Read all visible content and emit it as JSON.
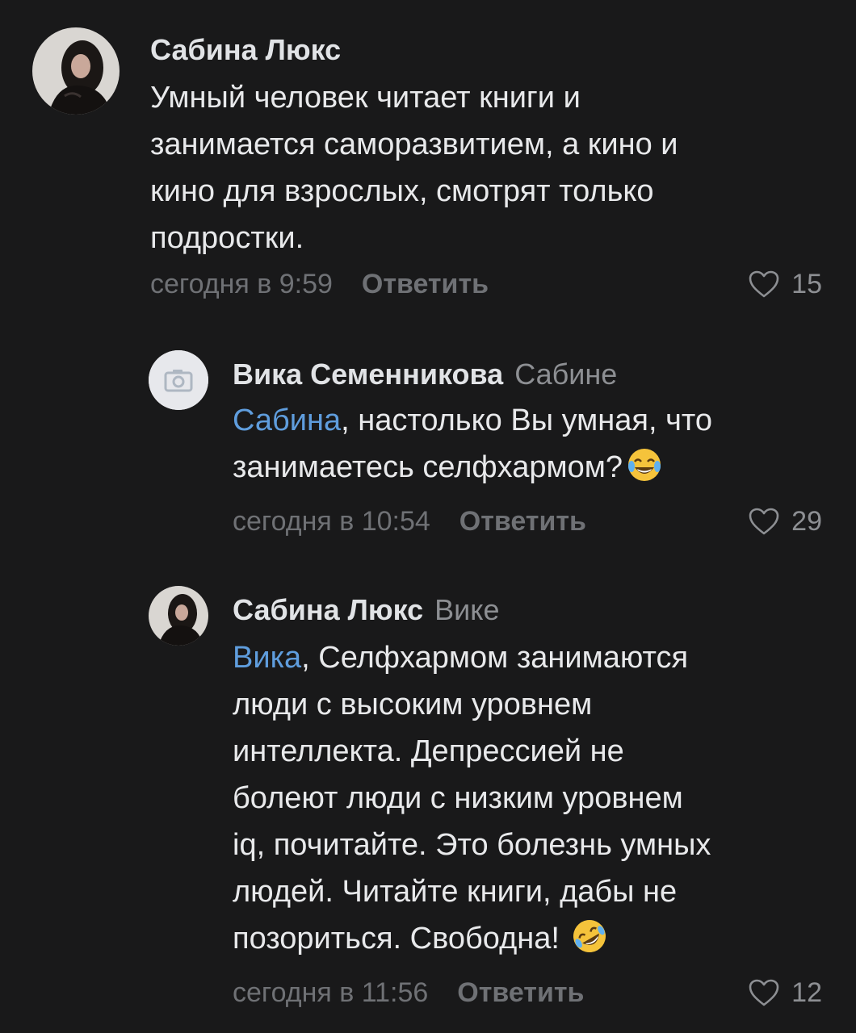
{
  "comments": [
    {
      "author": "Сабина Люкс",
      "reply_to": "",
      "mention": "",
      "lines": [
        "Умный человек читает книги и",
        "занимается саморазвитием, а кино и",
        "кино для взрослых, смотрят только",
        "подростки."
      ],
      "time": "сегодня в 9:59",
      "reply_label": "Ответить",
      "likes": "15",
      "avatar_icon": "user-photo-avatar"
    },
    {
      "author": "Вика Семенникова",
      "reply_to": "Сабине",
      "mention": "Сабина",
      "lines": [
        ", настолько Вы умная, что",
        "занимаетесь селфхармом?"
      ],
      "emoji": "face-with-tears-of-joy",
      "time": "сегодня в 10:54",
      "reply_label": "Ответить",
      "likes": "29",
      "avatar_icon": "camera-placeholder-icon"
    },
    {
      "author": "Сабина Люкс",
      "reply_to": "Вике",
      "mention": "Вика",
      "lines": [
        ", Селфхармом занимаются",
        "люди с высоким уровнем",
        "интеллекта. Депрессией не",
        "болеют люди с низким уровнем",
        "iq, почитайте. Это болезнь умных",
        "людей. Читайте книги, дабы не",
        "позориться. Свободна!"
      ],
      "emoji": "rolling-on-the-floor-laughing",
      "time": "сегодня в 11:56",
      "reply_label": "Ответить",
      "likes": "12",
      "avatar_icon": "user-photo-avatar"
    }
  ],
  "colors": {
    "background": "#19191a",
    "mention": "#5f9ddd",
    "secondary_text": "#6f7175"
  }
}
